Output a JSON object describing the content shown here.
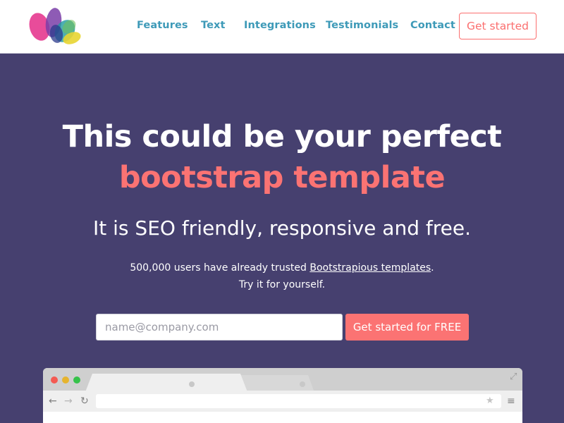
{
  "nav": {
    "links": [
      "Features",
      "Text",
      "Integrations",
      "Testimonials",
      "Contact"
    ],
    "cta_label": "Get started",
    "link_color": "#3e9ab8",
    "cta_color": "#fb6f6f"
  },
  "hero": {
    "title": "This could be your perfect",
    "title_accent": "bootstrap template",
    "subtitle": "It is SEO friendly, responsive and free.",
    "note_prefix": "500,000 users have already trusted ",
    "note_link": "Bootstrapious templates",
    "note_suffix": ".",
    "note_line2": "Try it for yourself.",
    "background_color": "#46406f",
    "accent_color": "#fb7373"
  },
  "signup": {
    "placeholder": "name@company.com",
    "button_label": "Get started for FREE"
  },
  "browser_mock": {
    "icons": [
      "close-dot",
      "minimize-dot",
      "maximize-dot",
      "expand-icon",
      "back-arrow-icon",
      "forward-arrow-icon",
      "reload-icon",
      "star-icon",
      "menu-icon"
    ]
  }
}
